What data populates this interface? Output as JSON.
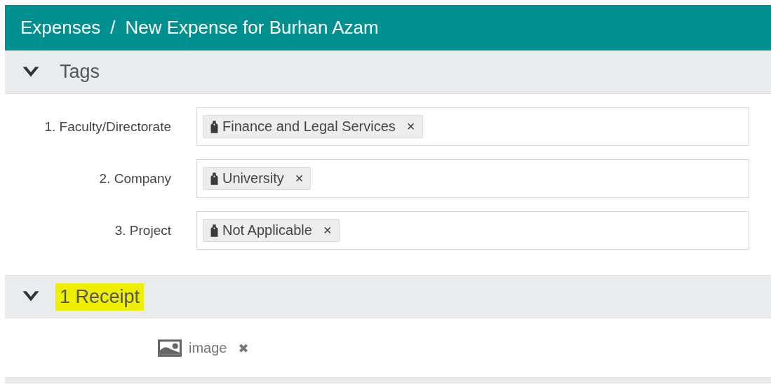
{
  "breadcrumb": [
    {
      "label": "Expenses"
    },
    {
      "label": "/"
    },
    {
      "label": "New Expense for Burhan Azam"
    }
  ],
  "tags_section": {
    "title": "Tags",
    "expanded": true,
    "highlighted": false,
    "fields": [
      {
        "label": "1. Faculty/Directorate",
        "tags": [
          {
            "label": "Finance and Legal Services",
            "remove": "×"
          }
        ]
      },
      {
        "label": "2. Company",
        "tags": [
          {
            "label": "University",
            "remove": "×"
          }
        ]
      },
      {
        "label": "3. Project",
        "tags": [
          {
            "label": "Not Applicable",
            "remove": "×"
          }
        ]
      }
    ]
  },
  "receipts_section": {
    "title": "1 Receipt",
    "expanded": true,
    "highlighted": true,
    "attachments": [
      {
        "name": "image",
        "remove": "✖"
      }
    ]
  }
}
